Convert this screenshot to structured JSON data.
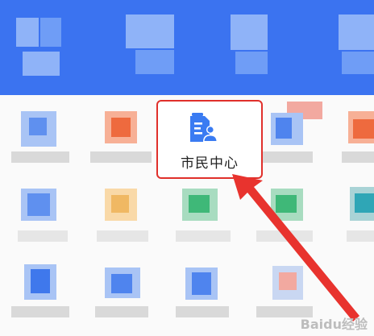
{
  "highlighted_service": {
    "label": "市民中心",
    "icon": "citizen-profile-document-icon"
  },
  "watermark": {
    "text": "Baidu经验"
  },
  "colors": {
    "header_blue": "#3b73f0",
    "highlight_red": "#e0302b",
    "arrow_red": "#e8332e",
    "icon_blue": "#3a7bf2"
  }
}
